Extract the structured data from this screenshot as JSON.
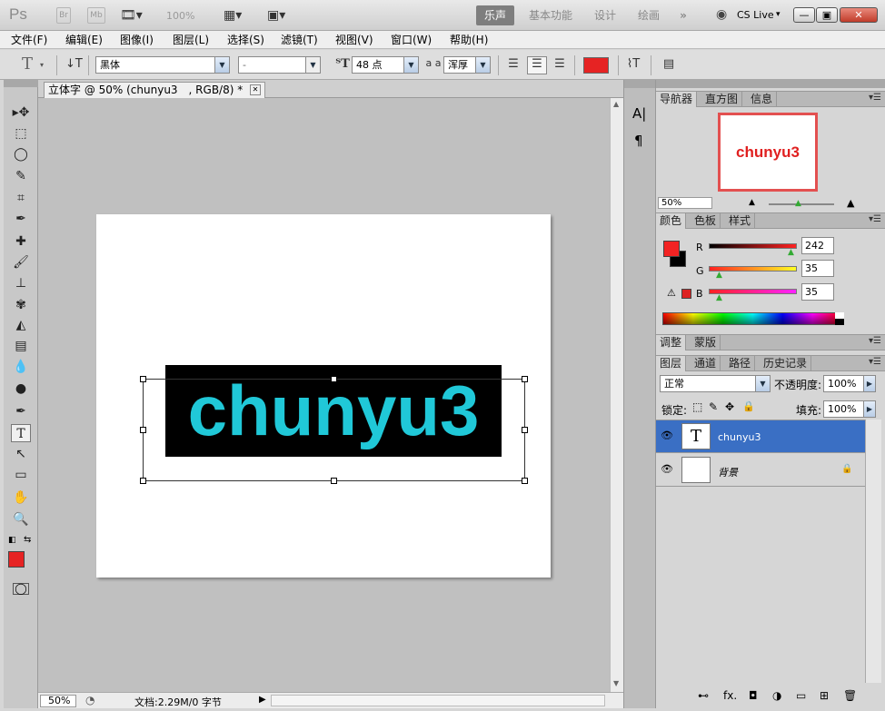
{
  "title_bar": {
    "logo": "Ps",
    "bridge": "Br",
    "minibridge": "Mb",
    "zoom": "100%",
    "workspaces": [
      "乐声",
      "基本功能",
      "设计",
      "绘画"
    ],
    "more": "»",
    "cs_live": "CS Live",
    "window_buttons": {
      "minimize": "—",
      "restore": "▣",
      "close": "✕"
    },
    "icons": [
      "film-icon",
      "arrange-icon",
      "screen-mode-icon",
      "cs-live-icon"
    ]
  },
  "menu": [
    "文件(F)",
    "编辑(E)",
    "图像(I)",
    "图层(L)",
    "选择(S)",
    "滤镜(T)",
    "视图(V)",
    "窗口(W)",
    "帮助(H)"
  ],
  "options": {
    "tool_glyph": "T",
    "font_family": "黑体",
    "font_style": "-",
    "font_size": "48 点",
    "aa_label": "a a",
    "antialias": "浑厚",
    "text_color": "#e62323",
    "icons": [
      "text-tool-icon",
      "orientation-toggle-icon",
      "font-size-icon",
      "align-left-icon",
      "align-center-icon",
      "align-right-icon",
      "warp-text-icon",
      "character-panel-icon"
    ]
  },
  "document": {
    "tab_label": "立体字 @ 50% (chunyu3　, RGB/8) *",
    "tab_close": "✕",
    "canvas_text": "chunyu3",
    "text_color": "#20c8d8",
    "text_bg_color": "#000000"
  },
  "status": {
    "zoom": "50%",
    "doc_info": "文档:2.29M/0 字节"
  },
  "tools": {
    "glyphs": [
      "▸✥",
      "⬚",
      "◯",
      "✎",
      "⌗",
      "✒",
      "✚",
      "🖌",
      "⊥",
      "✾",
      "◭",
      "▤",
      "💧",
      "●",
      "✒",
      "T",
      "↖",
      "▭",
      "✋",
      "🔍"
    ],
    "names": [
      "move-tool-icon",
      "marquee-tool-icon",
      "lasso-tool-icon",
      "quick-select-tool-icon",
      "crop-tool-icon",
      "eyedropper-tool-icon",
      "healing-tool-icon",
      "brush-tool-icon",
      "stamp-tool-icon",
      "history-brush-tool-icon",
      "eraser-tool-icon",
      "gradient-tool-icon",
      "blur-tool-icon",
      "dodge-tool-icon",
      "pen-tool-icon",
      "type-tool-icon",
      "path-select-tool-icon",
      "shape-tool-icon",
      "hand-tool-icon",
      "zoom-tool-icon"
    ],
    "fg_color": "#e62323",
    "bg_color": "#000000"
  },
  "side_strip": {
    "char_glyph": "A|",
    "para_glyph": "¶"
  },
  "navigator": {
    "tabs": [
      "导航器",
      "直方图",
      "信息"
    ],
    "preview_text": "chunyu3",
    "zoom": "50%"
  },
  "color_panel": {
    "tabs": [
      "颜色",
      "色板",
      "样式"
    ],
    "r_label": "R",
    "g_label": "G",
    "b_label": "B",
    "r": "242",
    "g": "35",
    "b": "35",
    "fg": "#f22323",
    "bg": "#000000"
  },
  "adjust_panel": {
    "tabs": [
      "调整",
      "蒙版"
    ]
  },
  "layers_panel": {
    "tabs": [
      "图层",
      "通道",
      "路径",
      "历史记录"
    ],
    "blend_mode": "正常",
    "opacity_label": "不透明度:",
    "opacity": "100%",
    "lock_label": "锁定:",
    "fill_label": "填充:",
    "fill": "100%",
    "layers": [
      {
        "name": "chunyu3",
        "thumb": "T",
        "selected": true
      },
      {
        "name": "背景",
        "thumb": "",
        "selected": false
      }
    ],
    "footer_icons": [
      "link-icon",
      "fx-icon",
      "mask-icon",
      "adjustment-icon",
      "group-icon",
      "new-layer-icon",
      "trash-icon"
    ],
    "footer_glyphs": [
      "⊷",
      "fx.",
      "◘",
      "◑",
      "▭",
      "⊞",
      "🗑"
    ]
  }
}
